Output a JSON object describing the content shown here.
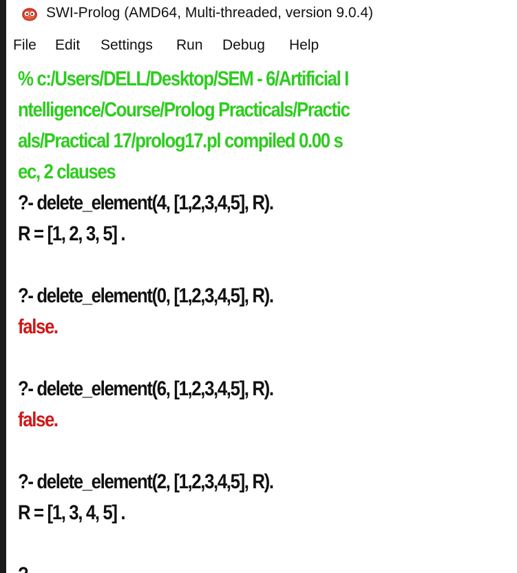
{
  "window": {
    "title": "SWI-Prolog (AMD64, Multi-threaded, version 9.0.4)"
  },
  "menu": {
    "file": "File",
    "edit": "Edit",
    "settings": "Settings",
    "run": "Run",
    "debug": "Debug",
    "help": "Help"
  },
  "console": {
    "compile_lines": [
      "% c:/Users/DELL/Desktop/SEM - 6/Artificial I",
      "ntelligence/Course/Prolog Practicals/Practic",
      "als/Practical 17/prolog17.pl compiled 0.00 s",
      "ec, 2 clauses"
    ],
    "q1": "?- delete_element(4, [1,2,3,4,5], R).",
    "a1": "R = [1, 2, 3, 5] .",
    "q2": "?- delete_element(0, [1,2,3,4,5], R).",
    "a2": "false.",
    "q3": "?- delete_element(6, [1,2,3,4,5], R).",
    "a3": "false.",
    "q4": "?- delete_element(2, [1,2,3,4,5], R).",
    "a4": "R = [1, 3, 4, 5] .",
    "prompt": "?-"
  },
  "colors": {
    "compile_text": "#2ecc1f",
    "false_text": "#d01818",
    "normal_text": "#111111"
  },
  "icons": {
    "app": "swi-prolog-owl-icon"
  }
}
